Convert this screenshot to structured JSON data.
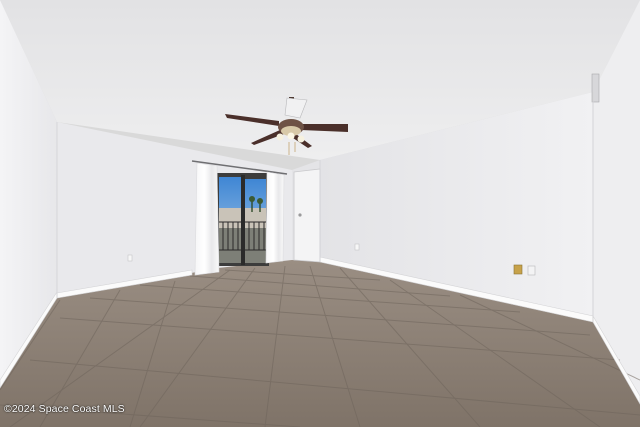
{
  "photo": {
    "subject": "empty room with ceiling fan and tile floor",
    "watermark": "©2024 Space Coast MLS"
  },
  "colors": {
    "ceiling": "#e9e9ea",
    "back_wall": "#e6e6e8",
    "right_wall": "#ececee",
    "left_wall": "#f0f0f2",
    "floor": "#8b7f74",
    "baseboard": "#fafafa",
    "fan_blade": "#4a2f2a",
    "sky": "#4a8fd6"
  }
}
